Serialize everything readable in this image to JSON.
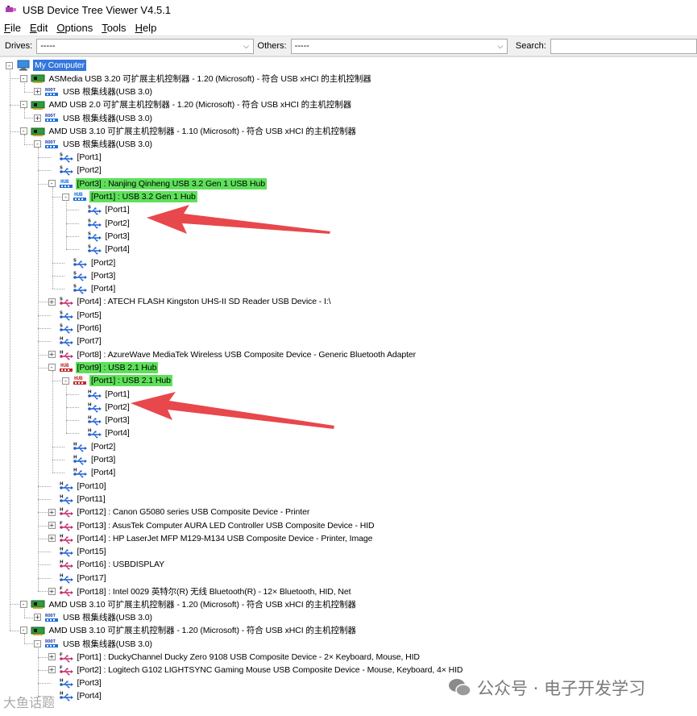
{
  "window": {
    "title": "USB Device Tree Viewer V4.5.1"
  },
  "menu": [
    {
      "key": "F",
      "rest": "ile"
    },
    {
      "key": "E",
      "rest": "dit"
    },
    {
      "key": "O",
      "rest": "ptions"
    },
    {
      "key": "T",
      "rest": "ools"
    },
    {
      "key": "H",
      "rest": "elp"
    }
  ],
  "toolbar": {
    "drives_label": "Drives:",
    "drives_value": "-----",
    "others_label": "Others:",
    "others_value": "-----",
    "search_label": "Search:",
    "search_value": ""
  },
  "tree": [
    {
      "depth": 0,
      "exp": "-",
      "icon": "computer",
      "label": "My Computer",
      "style": "sel"
    },
    {
      "depth": 1,
      "exp": "-",
      "icon": "controller",
      "label": "ASMedia USB 3.20 可扩展主机控制器 - 1.20 (Microsoft) - 符合 USB xHCI 的主机控制器"
    },
    {
      "depth": 2,
      "exp": "+",
      "icon": "roothub",
      "label": "USB 根集线器(USB 3.0)"
    },
    {
      "depth": 1,
      "exp": "-",
      "icon": "controller",
      "label": "AMD USB 2.0 可扩展主机控制器 - 1.20 (Microsoft) - 符合 USB xHCI 的主机控制器"
    },
    {
      "depth": 2,
      "exp": "+",
      "icon": "roothub",
      "label": "USB 根集线器(USB 3.0)"
    },
    {
      "depth": 1,
      "exp": "-",
      "icon": "controller",
      "label": "AMD USB 3.10 可扩展主机控制器 - 1.10 (Microsoft) - 符合 USB xHCI 的主机控制器"
    },
    {
      "depth": 2,
      "exp": "-",
      "icon": "roothub",
      "label": "USB 根集线器(USB 3.0)"
    },
    {
      "depth": 3,
      "exp": "",
      "icon": "port-s",
      "label": "[Port1]"
    },
    {
      "depth": 3,
      "exp": "",
      "icon": "port-s",
      "label": "[Port2]"
    },
    {
      "depth": 3,
      "exp": "-",
      "icon": "hub-blue",
      "label": "[Port3] : Nanjing Qinheng USB 3.2 Gen 1 USB Hub",
      "style": "hl"
    },
    {
      "depth": 4,
      "exp": "-",
      "icon": "hub-blue",
      "label": "[Port1] : USB 3.2 Gen 1 Hub",
      "style": "hl"
    },
    {
      "depth": 5,
      "exp": "",
      "icon": "port-s",
      "label": "[Port1]"
    },
    {
      "depth": 5,
      "exp": "",
      "icon": "port-s",
      "label": "[Port2]"
    },
    {
      "depth": 5,
      "exp": "",
      "icon": "port-s",
      "label": "[Port3]"
    },
    {
      "depth": 5,
      "exp": "",
      "icon": "port-s",
      "label": "[Port4]"
    },
    {
      "depth": 4,
      "exp": "",
      "icon": "port-s",
      "label": "[Port2]"
    },
    {
      "depth": 4,
      "exp": "",
      "icon": "port-s",
      "label": "[Port3]"
    },
    {
      "depth": 4,
      "exp": "",
      "icon": "port-s",
      "label": "[Port4]"
    },
    {
      "depth": 3,
      "exp": "+",
      "icon": "device-s",
      "label": "[Port4] : ATECH FLASH Kingston UHS-II SD Reader USB Device - I:\\"
    },
    {
      "depth": 3,
      "exp": "",
      "icon": "port-s",
      "label": "[Port5]"
    },
    {
      "depth": 3,
      "exp": "",
      "icon": "port-s",
      "label": "[Port6]"
    },
    {
      "depth": 3,
      "exp": "",
      "icon": "port-h",
      "label": "[Port7]"
    },
    {
      "depth": 3,
      "exp": "+",
      "icon": "device-h",
      "label": "[Port8] : AzureWave MediaTek Wireless USB Composite Device - Generic Bluetooth Adapter"
    },
    {
      "depth": 3,
      "exp": "-",
      "icon": "hub-red",
      "label": "[Port9] : USB 2.1 Hub",
      "style": "hl"
    },
    {
      "depth": 4,
      "exp": "-",
      "icon": "hub-red",
      "label": "[Port1] : USB 2.1 Hub",
      "style": "hl"
    },
    {
      "depth": 5,
      "exp": "",
      "icon": "port-h",
      "label": "[Port1]"
    },
    {
      "depth": 5,
      "exp": "",
      "icon": "port-h",
      "label": "[Port2]"
    },
    {
      "depth": 5,
      "exp": "",
      "icon": "port-h",
      "label": "[Port3]"
    },
    {
      "depth": 5,
      "exp": "",
      "icon": "port-h",
      "label": "[Port4]"
    },
    {
      "depth": 4,
      "exp": "",
      "icon": "port-h",
      "label": "[Port2]"
    },
    {
      "depth": 4,
      "exp": "",
      "icon": "port-h",
      "label": "[Port3]"
    },
    {
      "depth": 4,
      "exp": "",
      "icon": "port-h",
      "label": "[Port4]"
    },
    {
      "depth": 3,
      "exp": "",
      "icon": "port-h",
      "label": "[Port10]"
    },
    {
      "depth": 3,
      "exp": "",
      "icon": "port-h",
      "label": "[Port11]"
    },
    {
      "depth": 3,
      "exp": "+",
      "icon": "device-h",
      "label": "[Port12] : Canon G5080 series USB Composite Device - Printer"
    },
    {
      "depth": 3,
      "exp": "+",
      "icon": "device-f",
      "label": "[Port13] : AsusTek Computer AURA LED Controller USB Composite Device - HID"
    },
    {
      "depth": 3,
      "exp": "+",
      "icon": "device-h",
      "label": "[Port14] : HP LaserJet MFP M129-M134 USB Composite Device - Printer, Image"
    },
    {
      "depth": 3,
      "exp": "",
      "icon": "port-h",
      "label": "[Port15]"
    },
    {
      "depth": 3,
      "exp": "",
      "icon": "device-h",
      "label": "[Port16] : USBDISPLAY"
    },
    {
      "depth": 3,
      "exp": "",
      "icon": "port-h",
      "label": "[Port17]"
    },
    {
      "depth": 3,
      "exp": "+",
      "icon": "device-f",
      "label": "[Port18] : Intel 0029 英特尔(R) 无线 Bluetooth(R) - 12× Bluetooth, HID, Net"
    },
    {
      "depth": 1,
      "exp": "-",
      "icon": "controller",
      "label": "AMD USB 3.10 可扩展主机控制器 - 1.20 (Microsoft) - 符合 USB xHCI 的主机控制器"
    },
    {
      "depth": 2,
      "exp": "+",
      "icon": "roothub",
      "label": "USB 根集线器(USB 3.0)"
    },
    {
      "depth": 1,
      "exp": "-",
      "icon": "controller",
      "label": "AMD USB 3.10 可扩展主机控制器 - 1.20 (Microsoft) - 符合 USB xHCI 的主机控制器"
    },
    {
      "depth": 2,
      "exp": "-",
      "icon": "roothub",
      "label": "USB 根集线器(USB 3.0)"
    },
    {
      "depth": 3,
      "exp": "+",
      "icon": "device-f",
      "label": "[Port1] : DuckyChannel Ducky Zero 9108 USB Composite Device - 2× Keyboard, Mouse, HID"
    },
    {
      "depth": 3,
      "exp": "+",
      "icon": "device-f",
      "label": "[Port2] : Logitech G102 LIGHTSYNC Gaming Mouse USB Composite Device - Mouse, Keyboard, 4× HID"
    },
    {
      "depth": 3,
      "exp": "",
      "icon": "port-h",
      "label": "[Port3]"
    },
    {
      "depth": 3,
      "exp": "",
      "icon": "port-h",
      "label": "[Port4]"
    }
  ],
  "watermark_left": "大鱼话题",
  "watermark_right": "公众号 · 电子开发学习",
  "colors": {
    "highlight": "#5ee05a",
    "selection": "#3377dd",
    "annotation_arrow": "#e8474c"
  }
}
